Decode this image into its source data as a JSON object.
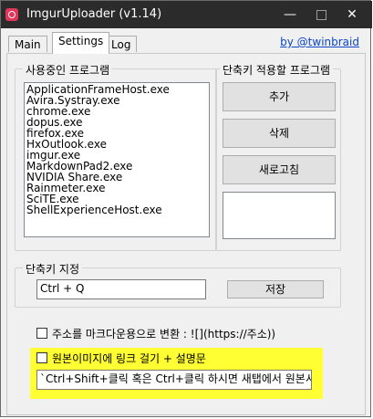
{
  "window": {
    "title": "ImgurUploader (v1.14)",
    "minimize_icon": "minimize-icon",
    "maximize_icon": "maximize-icon",
    "close_icon": "close-icon"
  },
  "tabs": [
    {
      "label": "Main",
      "active": false
    },
    {
      "label": "Settings",
      "active": true
    },
    {
      "label": "Log",
      "active": false
    }
  ],
  "author_link": "by @twinbraid",
  "running_programs": {
    "label": "사용중인 프로그램",
    "items": [
      " ApplicationFrameHost.exe",
      "Avira.Systray.exe",
      "chrome.exe",
      "dopus.exe",
      "firefox.exe",
      "HxOutlook.exe",
      "imgur.exe",
      "MarkdownPad2.exe",
      "NVIDIA Share.exe",
      "Rainmeter.exe",
      "SciTE.exe",
      "ShellExperienceHost.exe"
    ]
  },
  "target_programs": {
    "label": "단축키 적용할 프로그램",
    "add_label": "추가",
    "delete_label": "삭제",
    "refresh_label": "새로고침",
    "items": []
  },
  "hotkey": {
    "label": "단축키 지정",
    "value": "Ctrl + Q",
    "save_label": "저장"
  },
  "options": {
    "markdown_label": "주소를 마크다운용으로 변환 : ![](https://주소))",
    "link_label": "원본이미지에 링크 걸기 + 설명문",
    "description_value": "`Ctrl+Shift+클릭 혹은 Ctrl+클릭 하시면 새탭에서 원본시"
  },
  "colors": {
    "highlight": "#ffff33",
    "titlebar": "#2b2b2b",
    "link": "#0b47c7"
  }
}
